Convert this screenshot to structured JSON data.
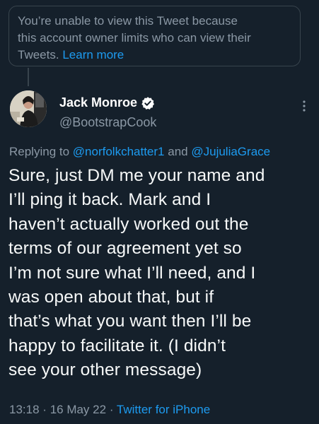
{
  "notice": {
    "line1": "You’re unable to view this Tweet because",
    "line2": "this account owner limits who can view their",
    "line3_prefix": "Tweets.",
    "learn_more": "Learn more"
  },
  "author": {
    "name": "Jack Monroe",
    "handle": "@BootstrapCook",
    "verified_icon": "verified-badge-icon",
    "more_icon": "more-options-icon"
  },
  "reply": {
    "prefix": "Replying to",
    "mention1": "@norfolkchatter1",
    "conjunction": "and",
    "mention2": "@JujuliaGrace"
  },
  "tweet": {
    "lines": [
      "Sure, just DM me your name and",
      "I’ll ping it back. Mark and I",
      "haven’t actually worked out the",
      "terms of our agreement yet so",
      "I’m not sure what I’ll need, and I",
      "was open about that, but if",
      "that’s what you want then I’ll be",
      "happy to facilitate it. (I didn’t",
      "see your other message)"
    ]
  },
  "meta": {
    "time": "13:18",
    "date": "16 May 22",
    "separator": "·",
    "source": "Twitter for iPhone"
  },
  "colors": {
    "background": "#15202b",
    "accent": "#1d9bf0",
    "secondary_text": "#8b98a5",
    "border": "#38444d"
  }
}
